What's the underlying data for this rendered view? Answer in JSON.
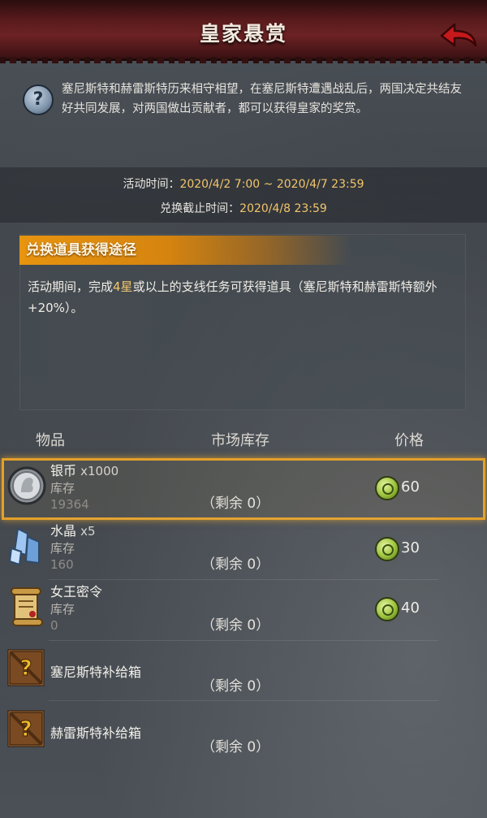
{
  "header": {
    "title": "皇家悬赏"
  },
  "info": {
    "help_symbol": "?",
    "description": "塞尼斯特和赫雷斯特历来相守相望，在塞尼斯特遭遇战乱后，两国决定共结友好共同发展，对两国做出贡献者，都可以获得皇家的奖赏。"
  },
  "time": {
    "event_label": "活动时间：",
    "event_value": "2020/4/2 7:00 ~ 2020/4/7 23:59",
    "deadline_label": "兑换截止时间：",
    "deadline_value": "2020/4/8 23:59"
  },
  "panel": {
    "title": "兑换道具获得途径",
    "body_a": "活动期间，完成",
    "body_hl": "4星",
    "body_b": "或以上的支线任务可获得道具（塞尼斯特和赫雷斯特额外+20%）。"
  },
  "columns": {
    "item": "物品",
    "stock": "市场库存",
    "price": "价格"
  },
  "items": [
    {
      "name": "银币",
      "qty": "x1000",
      "stock_label": "库存",
      "stock_value": "19364",
      "remain": "（剩余 0）",
      "price": "60"
    },
    {
      "name": "水晶",
      "qty": "x5",
      "stock_label": "库存",
      "stock_value": "160",
      "remain": "（剩余 0）",
      "price": "30"
    },
    {
      "name": "女王密令",
      "qty": "",
      "stock_label": "库存",
      "stock_value": "0",
      "remain": "（剩余 0）",
      "price": "40"
    },
    {
      "name": "塞尼斯特补给箱",
      "remain": "（剩余 0）"
    },
    {
      "name": "赫雷斯特补给箱",
      "remain": "（剩余 0）"
    }
  ],
  "colors": {
    "accent": "#e8940f",
    "selected_border": "#e3a02a",
    "header": "#5a1b1d",
    "highlight_text": "#f3c56b"
  }
}
